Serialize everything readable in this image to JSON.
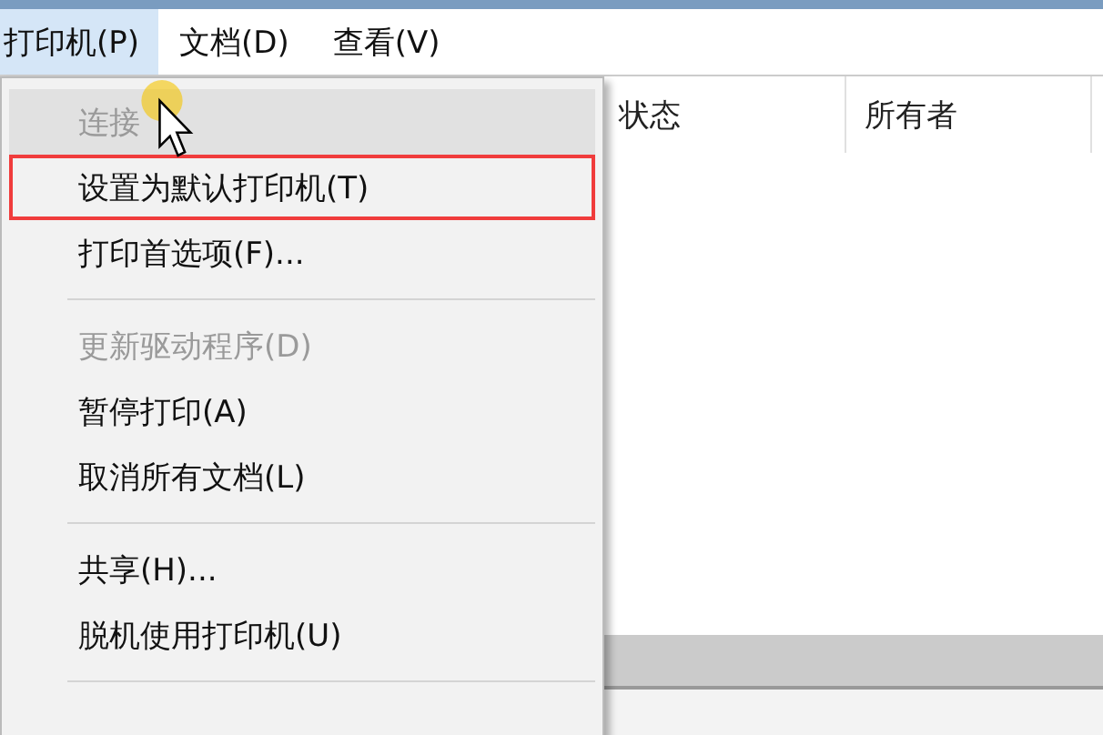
{
  "menubar": [
    {
      "label": "打印机(P)",
      "selected": true
    },
    {
      "label": "文档(D)",
      "selected": false
    },
    {
      "label": "查看(V)",
      "selected": false
    }
  ],
  "menu": {
    "items": [
      {
        "kind": "item",
        "label": "连接",
        "disabled": true,
        "hovered": true,
        "outlined": false
      },
      {
        "kind": "item",
        "label": "设置为默认打印机(T)",
        "disabled": false,
        "hovered": false,
        "outlined": true
      },
      {
        "kind": "item",
        "label": "打印首选项(F)...",
        "disabled": false,
        "hovered": false,
        "outlined": false
      },
      {
        "kind": "separator"
      },
      {
        "kind": "item",
        "label": "更新驱动程序(D)",
        "disabled": true,
        "hovered": false,
        "outlined": false
      },
      {
        "kind": "item",
        "label": "暂停打印(A)",
        "disabled": false,
        "hovered": false,
        "outlined": false
      },
      {
        "kind": "item",
        "label": "取消所有文档(L)",
        "disabled": false,
        "hovered": false,
        "outlined": false
      },
      {
        "kind": "separator"
      },
      {
        "kind": "item",
        "label": "共享(H)...",
        "disabled": false,
        "hovered": false,
        "outlined": false
      },
      {
        "kind": "item",
        "label": "脱机使用打印机(U)",
        "disabled": false,
        "hovered": false,
        "outlined": false
      },
      {
        "kind": "separator"
      }
    ]
  },
  "table": {
    "columns": [
      "状态",
      "所有者"
    ]
  }
}
